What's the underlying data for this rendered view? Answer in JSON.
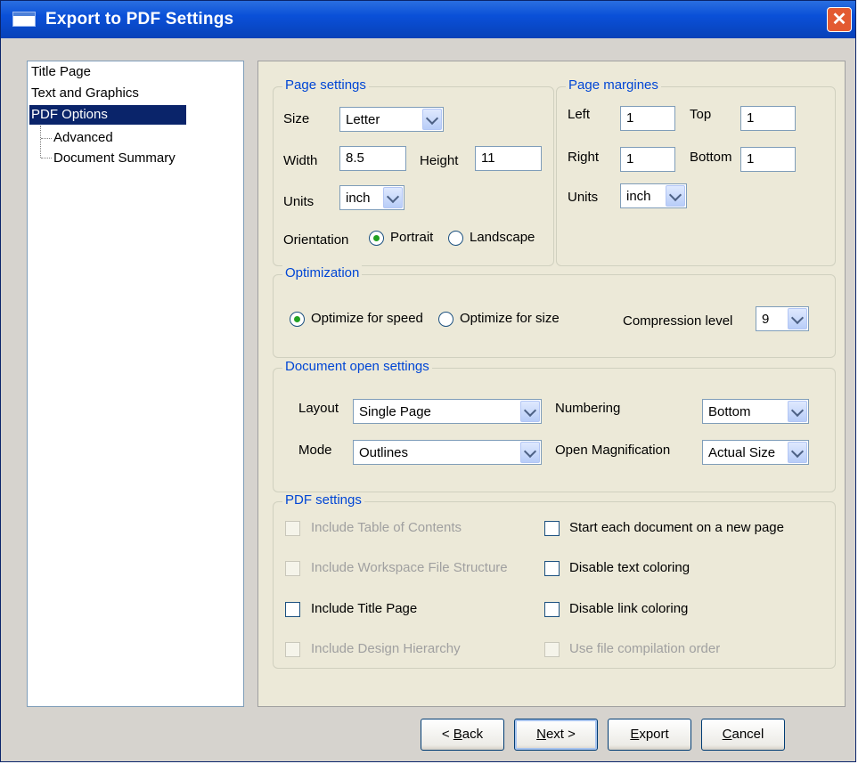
{
  "window": {
    "title": "Export to PDF Settings",
    "close_label": "✕"
  },
  "tree": {
    "items": [
      {
        "label": "Title Page"
      },
      {
        "label": "Text and Graphics"
      },
      {
        "label": "PDF Options",
        "selected": true
      },
      {
        "label": "Advanced"
      },
      {
        "label": "Document Summary"
      }
    ]
  },
  "page_settings": {
    "legend": "Page settings",
    "size_label": "Size",
    "size_value": "Letter",
    "width_label": "Width",
    "width_value": "8.5",
    "height_label": "Height",
    "height_value": "11",
    "units_label": "Units",
    "units_value": "inch",
    "orientation_label": "Orientation",
    "portrait_label": "Portrait",
    "landscape_label": "Landscape",
    "orientation_selected": "Portrait"
  },
  "page_margins": {
    "legend": "Page margines",
    "left_label": "Left",
    "left_value": "1",
    "top_label": "Top",
    "top_value": "1",
    "right_label": "Right",
    "right_value": "1",
    "bottom_label": "Bottom",
    "bottom_value": "1",
    "units_label": "Units",
    "units_value": "inch"
  },
  "optimization": {
    "legend": "Optimization",
    "speed_label": "Optimize for speed",
    "size_label": "Optimize for size",
    "selected": "speed",
    "compression_label": "Compression level",
    "compression_value": "9"
  },
  "document_open": {
    "legend": "Document open settings",
    "layout_label": "Layout",
    "layout_value": "Single Page",
    "mode_label": "Mode",
    "mode_value": "Outlines",
    "numbering_label": "Numbering",
    "numbering_value": "Bottom",
    "magnification_label": "Open Magnification",
    "magnification_value": "Actual Size"
  },
  "pdf_settings": {
    "legend": "PDF settings",
    "include_toc": {
      "label": "Include Table of Contents",
      "checked": false,
      "enabled": false
    },
    "include_workspace": {
      "label": "Include Workspace File Structure",
      "checked": false,
      "enabled": false
    },
    "include_title": {
      "label": "Include Title Page",
      "checked": false,
      "enabled": true
    },
    "include_hierarchy": {
      "label": "Include Design Hierarchy",
      "checked": false,
      "enabled": false
    },
    "start_new_page": {
      "label": "Start each document on a new page",
      "checked": false,
      "enabled": true
    },
    "disable_text_color": {
      "label": "Disable text coloring",
      "checked": false,
      "enabled": true
    },
    "disable_link_color": {
      "label": "Disable link coloring",
      "checked": false,
      "enabled": true
    },
    "use_compilation_order": {
      "label": "Use file compilation order",
      "checked": false,
      "enabled": false
    }
  },
  "buttons": {
    "back_prefix": "< ",
    "back_key": "B",
    "back_rest": "ack",
    "next_key": "N",
    "next_rest": "ext >",
    "export_key": "E",
    "export_rest": "xport",
    "cancel_key": "C",
    "cancel_rest": "ancel"
  }
}
